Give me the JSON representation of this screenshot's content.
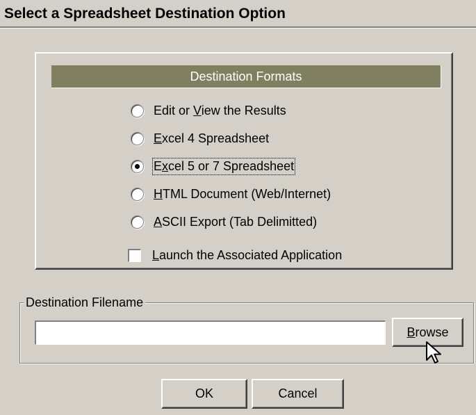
{
  "window": {
    "title": "Select a Spreadsheet Destination Option"
  },
  "formats": {
    "header": "Destination Formats",
    "options": [
      {
        "mnemonic_prefix": "Edit or ",
        "mnemonic": "V",
        "suffix": "iew the Results",
        "checked": false
      },
      {
        "mnemonic_prefix": "",
        "mnemonic": "E",
        "suffix": "xcel 4 Spreadsheet",
        "checked": false
      },
      {
        "mnemonic_prefix": "E",
        "mnemonic": "x",
        "suffix": "cel 5 or 7 Spreadsheet",
        "checked": true
      },
      {
        "mnemonic_prefix": "",
        "mnemonic": "H",
        "suffix": "TML Document (Web/Internet)",
        "checked": false
      },
      {
        "mnemonic_prefix": "",
        "mnemonic": "A",
        "suffix": "SCII Export (Tab Delimitted)",
        "checked": false
      }
    ],
    "launch": {
      "mnemonic": "L",
      "suffix": "aunch the Associated Application",
      "checked": false
    }
  },
  "filename": {
    "legend": "Destination Filename",
    "value": "",
    "browse": {
      "mnemonic": "B",
      "suffix": "rowse"
    }
  },
  "buttons": {
    "ok": "OK",
    "cancel": "Cancel"
  }
}
